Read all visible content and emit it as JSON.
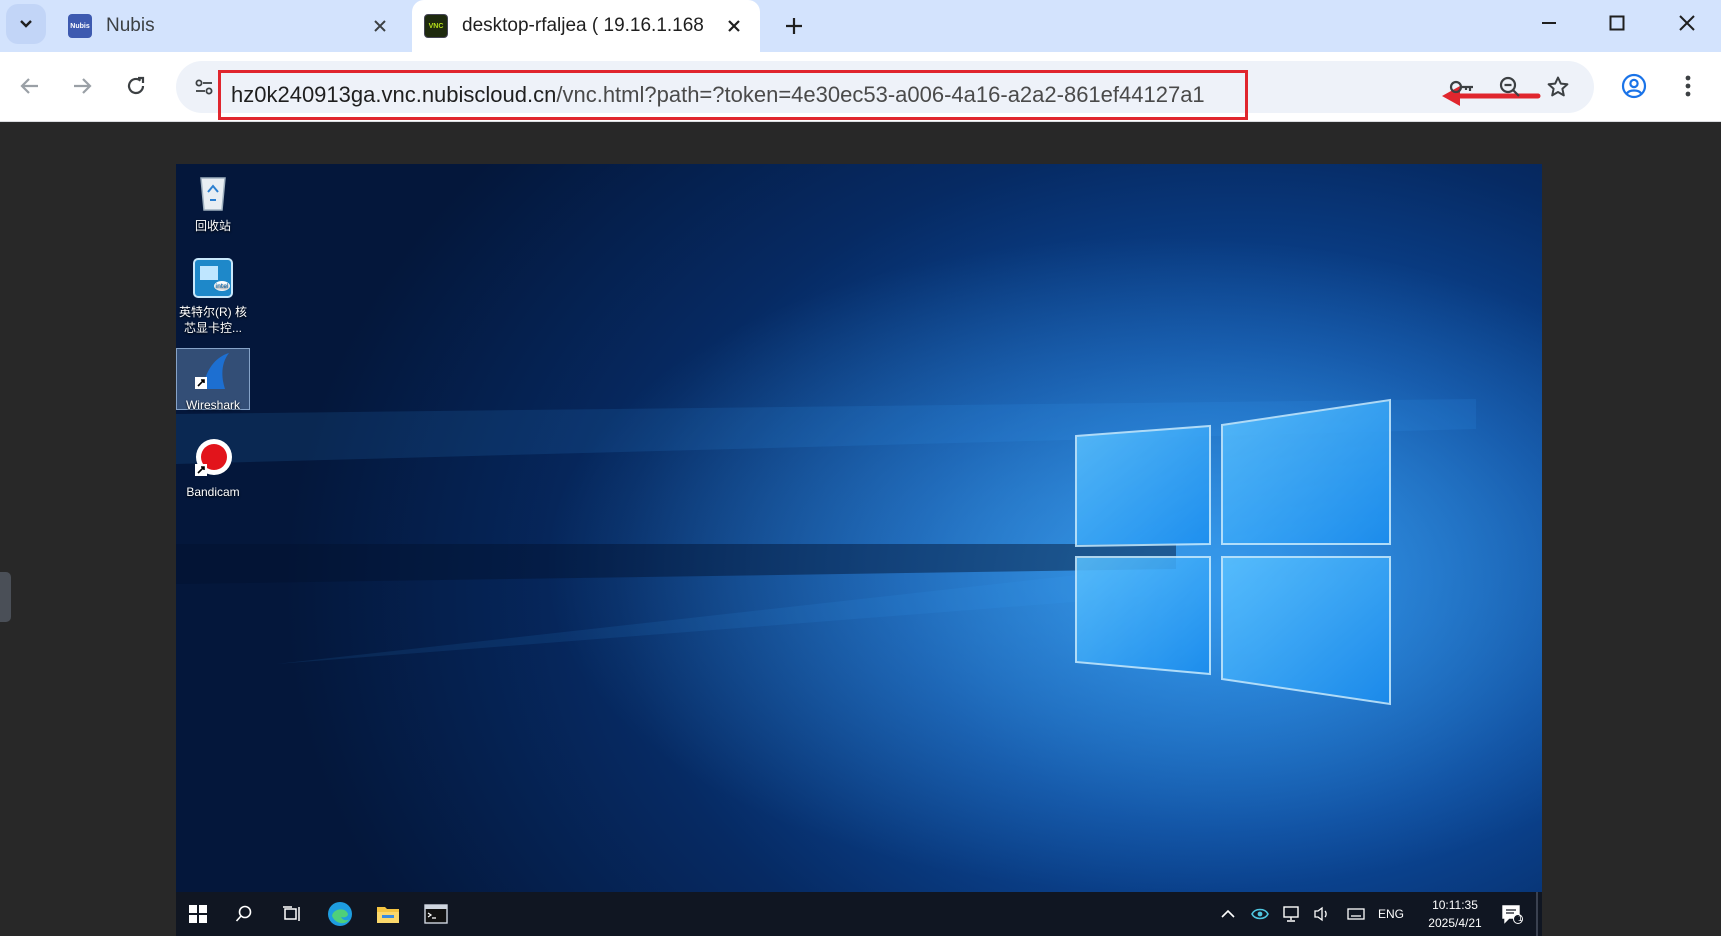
{
  "browser": {
    "tabs": [
      {
        "title": "Nubis",
        "favicon": "Nubis",
        "active": false
      },
      {
        "title": "desktop-rfaljea ( 19.16.1.168",
        "favicon": "VNC",
        "active": true
      }
    ],
    "url": {
      "host": "hz0k240913ga.vnc.nubiscloud.cn",
      "path": "/vnc.html?path=?token=4e30ec53-a006-4a16-a2a2-861ef44127a1"
    },
    "highlight_color": "#e0262e",
    "accent_color": "#1a73e8"
  },
  "desktop": {
    "icons": [
      {
        "label": "回收站",
        "icon": "recycle-bin-icon"
      },
      {
        "label": "英特尔(R) 核芯显卡控...",
        "icon": "intel-graphics-icon"
      },
      {
        "label": "Wireshark",
        "icon": "wireshark-icon",
        "selected": true
      },
      {
        "label": "Bandicam",
        "icon": "bandicam-icon"
      }
    ],
    "taskbar": {
      "language": "ENG",
      "time": "10:11:35",
      "date": "2025/4/21",
      "notification_count": "1"
    }
  }
}
